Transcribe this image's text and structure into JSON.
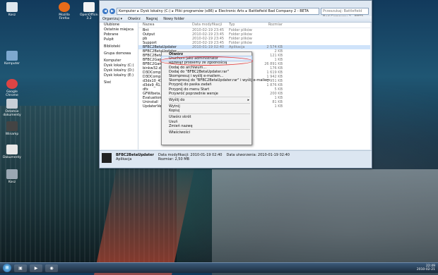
{
  "desktop_icons": [
    {
      "label": "Kosz",
      "name": "recycle-bin"
    },
    {
      "label": "Mozilla Firefox",
      "name": "firefox"
    },
    {
      "label": "OpenOffice.org 3.2",
      "name": "openoffice"
    },
    {
      "label": "Komputer",
      "name": "computer"
    },
    {
      "label": "Google Chrome",
      "name": "chrome"
    },
    {
      "label": "Ostatnie dokumenty",
      "name": "recent-docs"
    },
    {
      "label": "Winamp",
      "name": "winamp"
    },
    {
      "label": "Dokumenty",
      "name": "documents"
    },
    {
      "label": "Kosz",
      "name": "bin2"
    }
  ],
  "explorer": {
    "path": [
      "Komputer",
      "Dysk lokalny (C:)",
      "Pliki programów (x86)",
      "Electronic Arts",
      "Battlefield Bad Company 2 - BETA"
    ],
    "search_placeholder": "Przeszukaj: Battlefield Bad Company 2 - BETA",
    "toolbar": [
      "Organizuj ▾",
      "Otwórz",
      "Nagraj",
      "Nowy folder"
    ],
    "nav": [
      "Ulubione",
      "Ostatnie miejsca",
      "Pobrane",
      "Pulpit",
      "Biblioteki",
      "Grupa domowa",
      "Komputer",
      "Dysk lokalny (C:)",
      "Dysk lokalny (D:)",
      "Dysk lokalny (E:)",
      "Sieć"
    ],
    "headers": [
      "Nazwa",
      "Data modyfikacji",
      "Typ",
      "Rozmiar"
    ],
    "files": [
      {
        "name": "Bnt",
        "date": "2010-02-19 23:45",
        "type": "Folder plików",
        "size": ""
      },
      {
        "name": "Output",
        "date": "2010-02-19 23:45",
        "type": "Folder plików",
        "size": ""
      },
      {
        "name": "pb",
        "date": "2010-02-19 23:45",
        "type": "Folder plików",
        "size": ""
      },
      {
        "name": "Support",
        "date": "2010-02-19 23:45",
        "type": "Folder plików",
        "size": ""
      },
      {
        "name": "BFBC2BetaUpdater",
        "date": "2010-01-19 02:40",
        "type": "Aplikacja",
        "size": "2 574 KB"
      },
      {
        "name": "BFBC2BetaUpdater",
        "date": "",
        "type": "",
        "size": "2 KB"
      },
      {
        "name": "BFBC2BetaUpd",
        "date": "",
        "type": "",
        "size": "121 KB"
      },
      {
        "name": "BFBC2Game",
        "date": "",
        "type": "",
        "size": "1 KB"
      },
      {
        "name": "BFBC2Game",
        "date": "",
        "type": "",
        "size": "26 891 KB"
      },
      {
        "name": "binkw32.dll",
        "date": "",
        "type": "",
        "size": "176 KB"
      },
      {
        "name": "D3DCompile",
        "date": "",
        "type": "",
        "size": "1 619 KB"
      },
      {
        "name": "D3DCompile",
        "date": "",
        "type": "",
        "size": "1 942 KB"
      },
      {
        "name": "d3dx10_41.dll",
        "date": "",
        "type": "",
        "size": "1 951 KB"
      },
      {
        "name": "d3dx9_41.dll",
        "date": "",
        "type": "",
        "size": "1 876 KB"
      },
      {
        "name": "dfx",
        "date": "",
        "type": "",
        "size": "5 KB"
      },
      {
        "name": "GFWlbeta.dll",
        "date": "",
        "type": "",
        "size": "200 KB"
      },
      {
        "name": "EvaluationDefinition",
        "date": "",
        "type": "",
        "size": "1 KB"
      },
      {
        "name": "Uninstall",
        "date": "",
        "type": "",
        "size": "81 KB"
      },
      {
        "name": "UpdaterVersion",
        "date": "",
        "type": "",
        "size": "1 KB"
      }
    ],
    "details": {
      "file_name": "BFBC2BetaUpdater",
      "kind": "Aplikacja",
      "modified_label": "Data modyfikacji: 2010-01-19 02:40",
      "created_label": "Data utworzenia: 2010-01-19 02:40",
      "size_label": "Rozmiar: 2,50 MB"
    }
  },
  "context_menu": [
    {
      "label": "Otwórz",
      "bold": true
    },
    {
      "label": "Uruchom jako administrator",
      "highlight": true
    },
    {
      "label": "Rozwiąż problemy ze zgodnością"
    },
    {
      "label": "Dodaj do archiwum..."
    },
    {
      "label": "Dodaj do \"BFBC2BetaUpdater.rar\""
    },
    {
      "label": "Skompresuj i wyślij e-mailem..."
    },
    {
      "label": "Skompresuj do \"BFBC2BetaUpdater.rar\" i wyślij e-mailem"
    },
    {
      "label": "Przypnij do paska zadań"
    },
    {
      "label": "Przypnij do menu Start"
    },
    {
      "label": "Przywróć poprzednie wersje"
    },
    {
      "sep": true
    },
    {
      "label": "Wyślij do",
      "submenu": true
    },
    {
      "sep": true
    },
    {
      "label": "Wytnij"
    },
    {
      "label": "Kopiuj"
    },
    {
      "sep": true
    },
    {
      "label": "Utwórz skrót"
    },
    {
      "label": "Usuń"
    },
    {
      "label": "Zmień nazwę"
    },
    {
      "sep": true
    },
    {
      "label": "Właściwości"
    }
  ],
  "taskbar": {
    "time": "22:49",
    "date": "2010-02-21"
  },
  "colors": {
    "accent": "#3b78c6",
    "highlight_circle": "#e23b3b"
  }
}
